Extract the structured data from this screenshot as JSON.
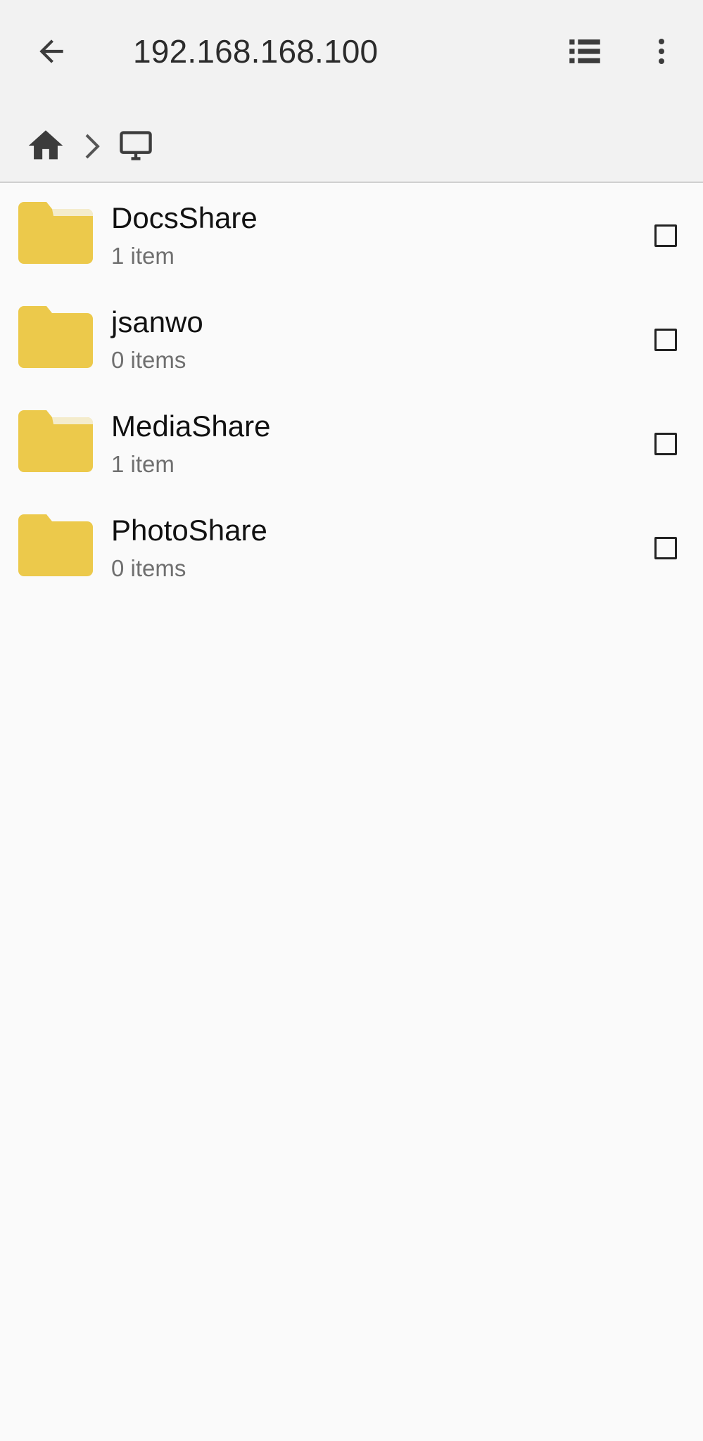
{
  "appbar": {
    "title": "192.168.168.100",
    "back_icon": "arrow-back-icon",
    "list_view_icon": "list-view-icon",
    "more_icon": "more-vert-icon"
  },
  "breadcrumb": {
    "home_icon": "home-icon",
    "separator_icon": "chevron-right-icon",
    "device_icon": "monitor-icon"
  },
  "colors": {
    "appbar_bg": "#f2f2f2",
    "list_bg": "#fafafa",
    "folder": "#ecc94b",
    "icon": "#3c3c3c",
    "subtitle": "#6f6f6f"
  },
  "files": [
    {
      "name": "DocsShare",
      "meta": "1 item"
    },
    {
      "name": "jsanwo",
      "meta": "0 items"
    },
    {
      "name": "MediaShare",
      "meta": "1 item"
    },
    {
      "name": "PhotoShare",
      "meta": "0 items"
    }
  ]
}
